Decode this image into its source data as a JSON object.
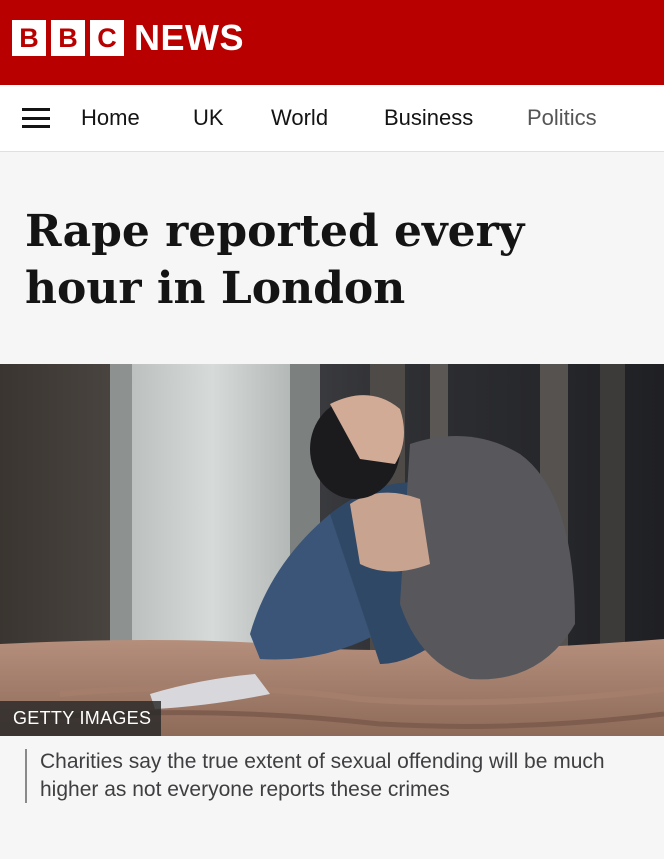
{
  "header": {
    "logo_letters": [
      "B",
      "B",
      "C"
    ],
    "logo_word": "NEWS",
    "brand_color": "#b80000"
  },
  "nav": {
    "menu_icon": "hamburger-menu-icon",
    "items": [
      {
        "label": "Home"
      },
      {
        "label": "UK"
      },
      {
        "label": "World"
      },
      {
        "label": "Business"
      },
      {
        "label": "Politics"
      }
    ]
  },
  "article": {
    "headline": "Rape reported every hour in London",
    "image_credit": "GETTY IMAGES",
    "image_caption": "Charities say the true extent of sexual offending will be much higher as not everyone reports these crimes"
  }
}
